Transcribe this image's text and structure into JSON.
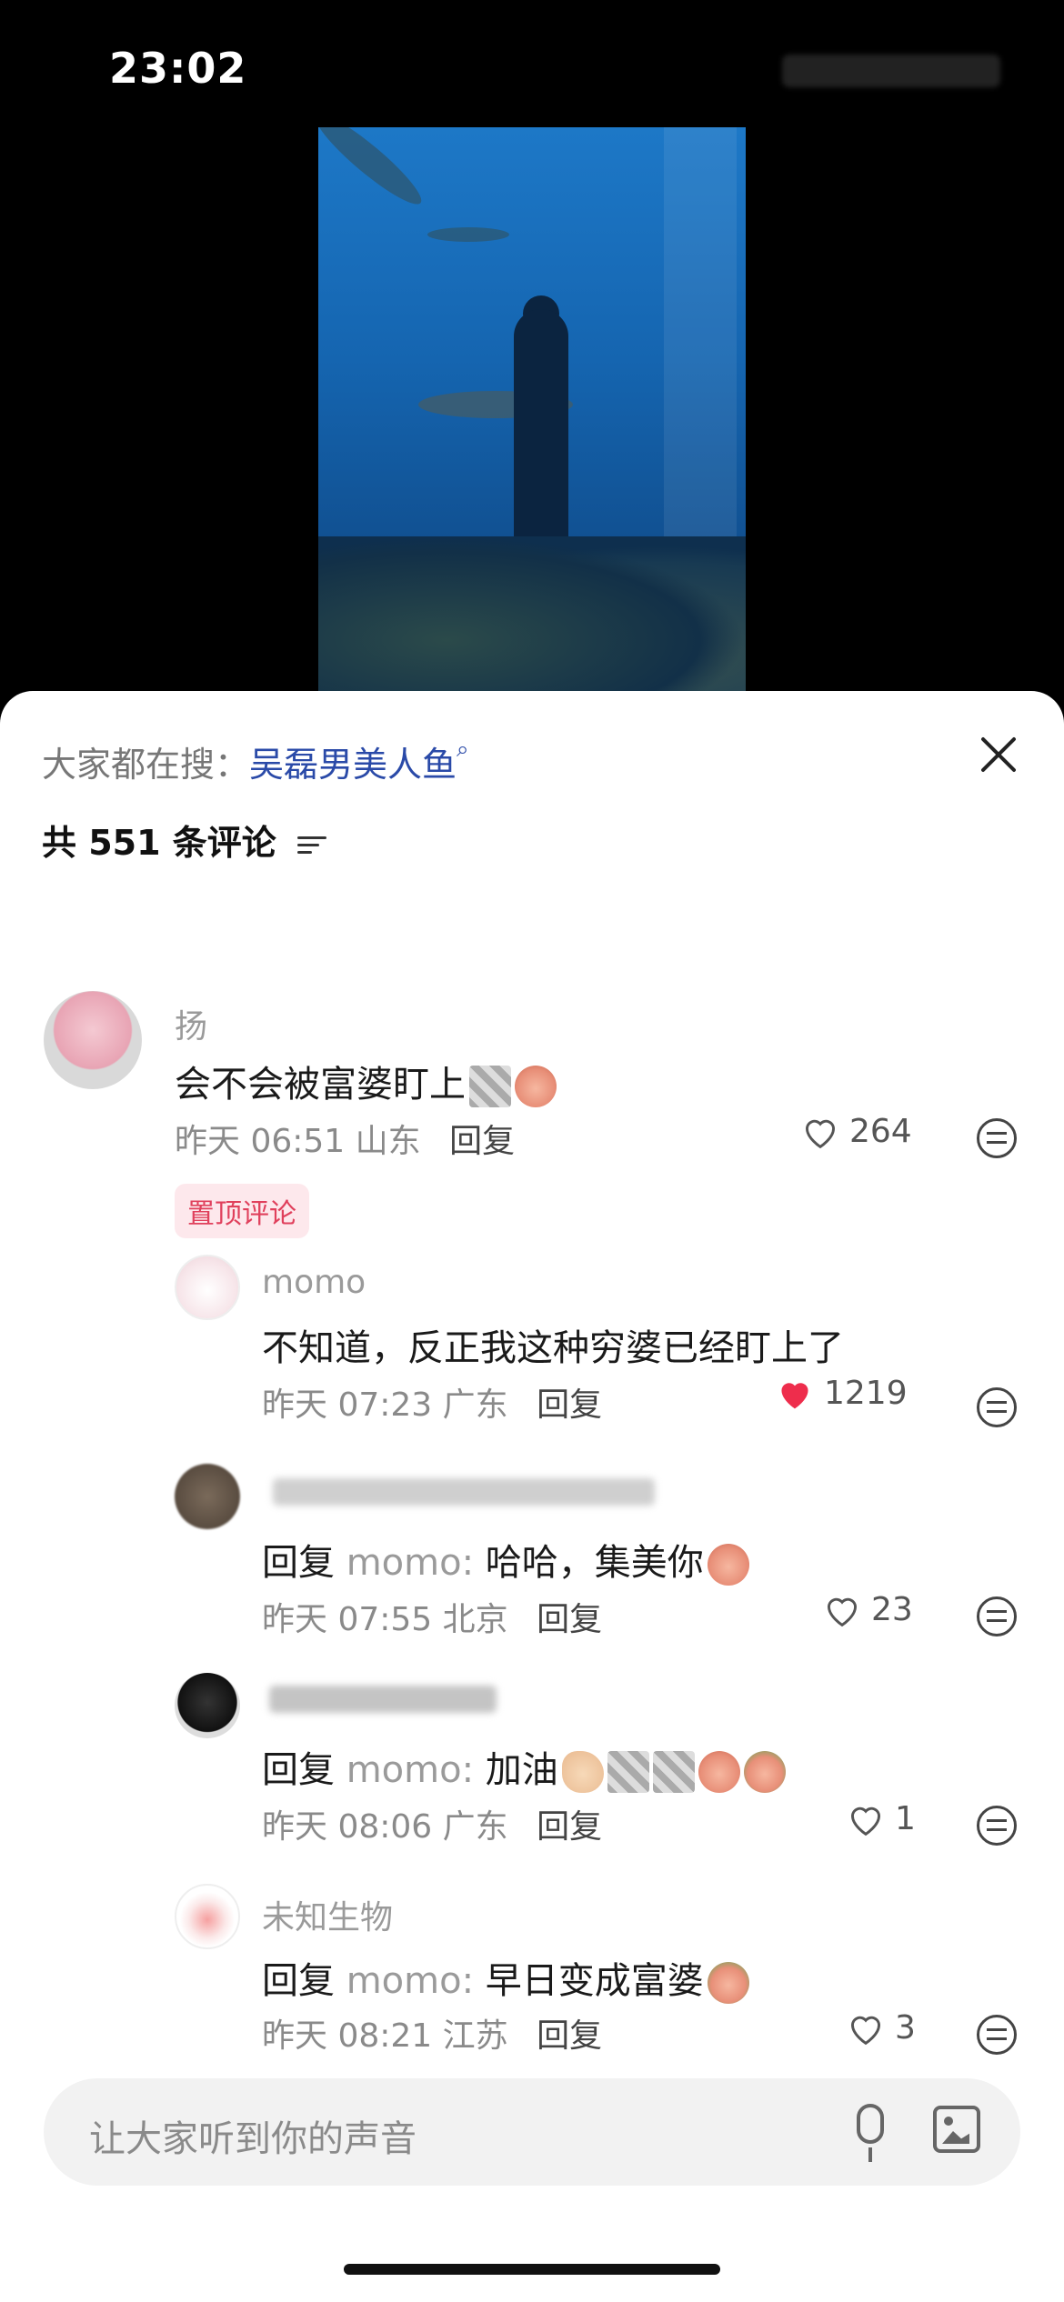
{
  "status": {
    "time": "23:02"
  },
  "sheet": {
    "search_prefix": "大家都在搜：",
    "search_term": "吴磊男美人鱼",
    "comment_count": "共 551 条评论"
  },
  "comments": [
    {
      "name": "扬",
      "text": "会不会被富婆盯上",
      "time": "昨天 06:51",
      "location": "山东",
      "reply": "回复",
      "likes": "264",
      "pinned": "置顶评论"
    },
    {
      "name": "momo",
      "text": "不知道，反正我这种穷婆已经盯上了",
      "time": "昨天 07:23",
      "location": "广东",
      "reply": "回复",
      "likes": "1219"
    },
    {
      "reply_prefix": "回复",
      "reply_to": "momo:",
      "text": "哈哈，集美你",
      "time": "昨天 07:55",
      "location": "北京",
      "reply": "回复",
      "likes": "23"
    },
    {
      "reply_prefix": "回复",
      "reply_to": "momo:",
      "text": "加油",
      "time": "昨天 08:06",
      "location": "广东",
      "reply": "回复",
      "likes": "1"
    },
    {
      "name": "未知生物",
      "reply_prefix": "回复",
      "reply_to": "momo:",
      "text": "早日变成富婆",
      "time": "昨天 08:21",
      "location": "江苏",
      "reply": "回复",
      "likes": "3"
    }
  ],
  "input": {
    "placeholder": "让大家听到你的声音"
  },
  "colors": {
    "liked": "#ee2d4c",
    "search_term": "#2a4aa8"
  }
}
